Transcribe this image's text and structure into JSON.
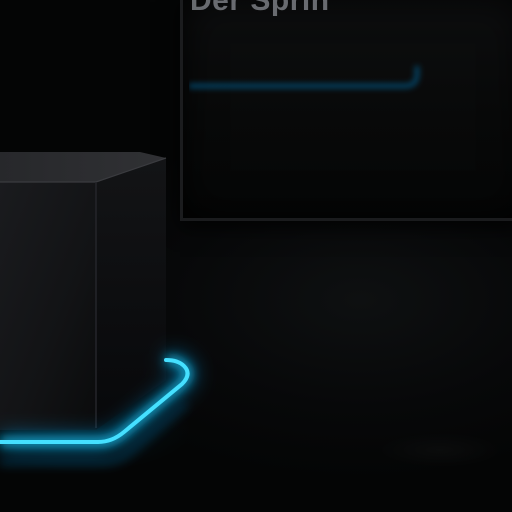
{
  "scene": {
    "panel_title": "Der Sprin",
    "colors": {
      "neon": "#19c9f5",
      "neon_glow": "#0a8fd6",
      "background": "#050607",
      "cube_front": "#141517",
      "cube_top": "#2a2b2e",
      "cube_side": "#0c0d0e",
      "title_text": "#7a7d82"
    }
  }
}
